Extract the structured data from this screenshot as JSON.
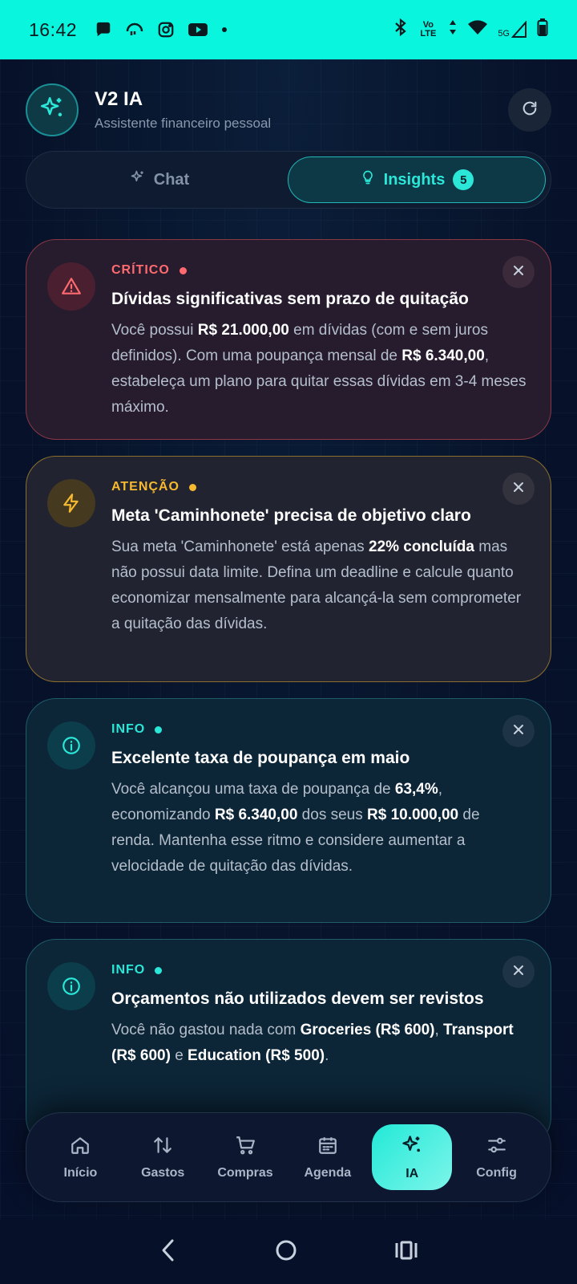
{
  "status_bar": {
    "time": "16:42",
    "left_icons": [
      "chat-bubble-icon",
      "headset-icon",
      "instagram-icon",
      "youtube-icon",
      "dot-icon"
    ],
    "right_icons": [
      "bluetooth-icon",
      "volte-icon",
      "data-arrows-icon",
      "wifi-icon",
      "signal-5g-icon",
      "battery-icon"
    ],
    "volte_label": "Vo LTE",
    "network_label": "5G",
    "background": "#0af5dd"
  },
  "header": {
    "title": "V2 IA",
    "subtitle": "Assistente financeiro pessoal"
  },
  "tabs": [
    {
      "label": "Chat",
      "active": false
    },
    {
      "label": "Insights",
      "active": true,
      "badge": "5"
    }
  ],
  "insights": [
    {
      "level": "CRÍTICO",
      "color": "#ff6a6f",
      "icon": "warning-icon",
      "title": "Dívidas significativas sem prazo de quitação",
      "body": [
        {
          "t": "Você possui "
        },
        {
          "t": "R$ 21.000,00",
          "b": true
        },
        {
          "t": " em dívidas (com e sem juros definidos). Com uma poupança mensal de "
        },
        {
          "t": "R$ 6.340,00",
          "b": true
        },
        {
          "t": ", estabeleça um plano para quitar essas dívidas em 3-4 meses máximo."
        }
      ]
    },
    {
      "level": "ATENÇÃO",
      "color": "#f6b92f",
      "icon": "lightning-icon",
      "title": "Meta 'Caminhonete' precisa de objetivo claro",
      "body": [
        {
          "t": "Sua meta 'Caminhonete' está apenas "
        },
        {
          "t": "22% concluída",
          "b": true
        },
        {
          "t": " mas não possui data limite. Defina um deadline e calcule quanto economizar mensalmente para alcançá-la sem comprometer a quitação das dívidas."
        }
      ]
    },
    {
      "level": "INFO",
      "color": "#2be7d8",
      "icon": "info-icon",
      "title": "Excelente taxa de poupança em maio",
      "body": [
        {
          "t": "Você alcançou uma taxa de poupança de "
        },
        {
          "t": "63,4%",
          "b": true
        },
        {
          "t": ", economizando "
        },
        {
          "t": "R$ 6.340,00",
          "b": true
        },
        {
          "t": " dos seus "
        },
        {
          "t": "R$ 10.000,00",
          "b": true
        },
        {
          "t": " de renda. Mantenha esse ritmo e considere aumentar a velocidade de quitação das dívidas."
        }
      ]
    },
    {
      "level": "INFO",
      "color": "#2be7d8",
      "icon": "info-icon",
      "title": "Orçamentos não utilizados devem ser revistos",
      "body": [
        {
          "t": "Você não gastou nada com "
        },
        {
          "t": "Groceries (R$ 600)",
          "b": true
        },
        {
          "t": ", "
        },
        {
          "t": "Transport (R$ 600)",
          "b": true
        },
        {
          "t": " e "
        },
        {
          "t": "Education (R$ 500)",
          "b": true
        },
        {
          "t": "."
        }
      ]
    }
  ],
  "bottom_nav": [
    {
      "label": "Início",
      "icon": "home-icon",
      "active": false
    },
    {
      "label": "Gastos",
      "icon": "sort-arrows-icon",
      "active": false
    },
    {
      "label": "Compras",
      "icon": "cart-icon",
      "active": false
    },
    {
      "label": "Agenda",
      "icon": "calendar-icon",
      "active": false
    },
    {
      "label": "IA",
      "icon": "sparkle-icon",
      "active": true
    },
    {
      "label": "Config",
      "icon": "sliders-icon",
      "active": false
    }
  ],
  "system_nav": [
    "back-icon",
    "home-circle-icon",
    "recents-icon"
  ]
}
